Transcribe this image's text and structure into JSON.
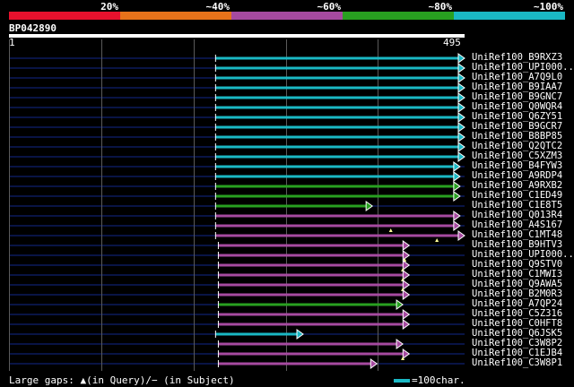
{
  "header": {
    "identity_scale": [
      {
        "label": "20%",
        "color": "#e8112d"
      },
      {
        "label": "~40%",
        "color": "#e8731a"
      },
      {
        "label": "~60%",
        "color": "#a64aa0"
      },
      {
        "label": "~80%",
        "color": "#28a020"
      },
      {
        "label": "~100%",
        "color": "#1ab8c4"
      }
    ],
    "query_id": "BP042890"
  },
  "ruler": {
    "start": "1",
    "end": "495"
  },
  "footer": {
    "gaps_text": "Large gaps: ▲(in Query)/− (in Subject)",
    "legend_text": "=100char."
  },
  "chart_data": {
    "type": "alignment",
    "query_length": 495,
    "hits": [
      {
        "name": "UniRef100_B9RXZ3",
        "q_start": 225,
        "q_end": 495,
        "color": "cyan"
      },
      {
        "name": "UniRef100_UPI000..",
        "q_start": 225,
        "q_end": 495,
        "color": "cyan"
      },
      {
        "name": "UniRef100_A7Q9L0",
        "q_start": 225,
        "q_end": 495,
        "color": "cyan"
      },
      {
        "name": "UniRef100_B9IAA7",
        "q_start": 225,
        "q_end": 495,
        "color": "cyan"
      },
      {
        "name": "UniRef100_B9GNC7",
        "q_start": 225,
        "q_end": 495,
        "color": "cyan"
      },
      {
        "name": "UniRef100_Q0WQR4",
        "q_start": 225,
        "q_end": 495,
        "color": "cyan"
      },
      {
        "name": "UniRef100_Q6ZY51",
        "q_start": 225,
        "q_end": 495,
        "color": "cyan"
      },
      {
        "name": "UniRef100_B9GCR7",
        "q_start": 225,
        "q_end": 495,
        "color": "cyan"
      },
      {
        "name": "UniRef100_B8BP85",
        "q_start": 225,
        "q_end": 495,
        "color": "cyan"
      },
      {
        "name": "UniRef100_Q2QTC2",
        "q_start": 225,
        "q_end": 495,
        "color": "cyan"
      },
      {
        "name": "UniRef100_C5XZM3",
        "q_start": 225,
        "q_end": 495,
        "color": "cyan"
      },
      {
        "name": "UniRef100_B4FYW3",
        "q_start": 225,
        "q_end": 490,
        "color": "cyan"
      },
      {
        "name": "UniRef100_A9RDP4",
        "q_start": 225,
        "q_end": 490,
        "color": "cyan"
      },
      {
        "name": "UniRef100_A9RXB2",
        "q_start": 225,
        "q_end": 490,
        "color": "green"
      },
      {
        "name": "UniRef100_C1ED49",
        "q_start": 225,
        "q_end": 490,
        "color": "green"
      },
      {
        "name": "UniRef100_C1E8T5",
        "q_start": 225,
        "q_end": 395,
        "color": "green"
      },
      {
        "name": "UniRef100_Q013R4",
        "q_start": 225,
        "q_end": 490,
        "color": "purple"
      },
      {
        "name": "UniRef100_A4S167",
        "q_start": 225,
        "q_end": 490,
        "color": "purple",
        "query_gap_at": 415
      },
      {
        "name": "UniRef100_C1MT48",
        "q_start": 225,
        "q_end": 495,
        "color": "purple",
        "query_gap_at": 465
      },
      {
        "name": "UniRef100_B9HTV3",
        "q_start": 228,
        "q_end": 435,
        "color": "purple"
      },
      {
        "name": "UniRef100_UPI000..",
        "q_start": 228,
        "q_end": 435,
        "color": "purple",
        "query_gap_at": 430
      },
      {
        "name": "UniRef100_Q9STV0",
        "q_start": 228,
        "q_end": 435,
        "color": "purple",
        "query_gap_at": 428
      },
      {
        "name": "UniRef100_C1MWI3",
        "q_start": 228,
        "q_end": 435,
        "color": "purple",
        "query_gap_at": 428
      },
      {
        "name": "UniRef100_Q9AWA5",
        "q_start": 228,
        "q_end": 435,
        "color": "purple",
        "query_gap_at": 428
      },
      {
        "name": "UniRef100_B2M0R3",
        "q_start": 228,
        "q_end": 435,
        "color": "purple"
      },
      {
        "name": "UniRef100_A7QP24",
        "q_start": 228,
        "q_end": 428,
        "color": "green"
      },
      {
        "name": "UniRef100_C5Z316",
        "q_start": 228,
        "q_end": 435,
        "color": "purple"
      },
      {
        "name": "UniRef100_C0HFT8",
        "q_start": 228,
        "q_end": 435,
        "color": "purple"
      },
      {
        "name": "UniRef100_Q6JSK5",
        "q_start": 225,
        "q_end": 320,
        "color": "cyan"
      },
      {
        "name": "UniRef100_C3W8P2",
        "q_start": 228,
        "q_end": 428,
        "color": "purple"
      },
      {
        "name": "UniRef100_C1EJB4",
        "q_start": 228,
        "q_end": 435,
        "color": "purple",
        "query_gap_at": 428
      },
      {
        "name": "UniRef100_C3W8P1",
        "q_start": 228,
        "q_end": 400,
        "color": "purple"
      }
    ]
  },
  "colors": {
    "cyan": "#1ab8c4",
    "green": "#28a020",
    "purple": "#a64aa0",
    "track": "#0c1a5c",
    "grid": "#5a5a5a"
  }
}
